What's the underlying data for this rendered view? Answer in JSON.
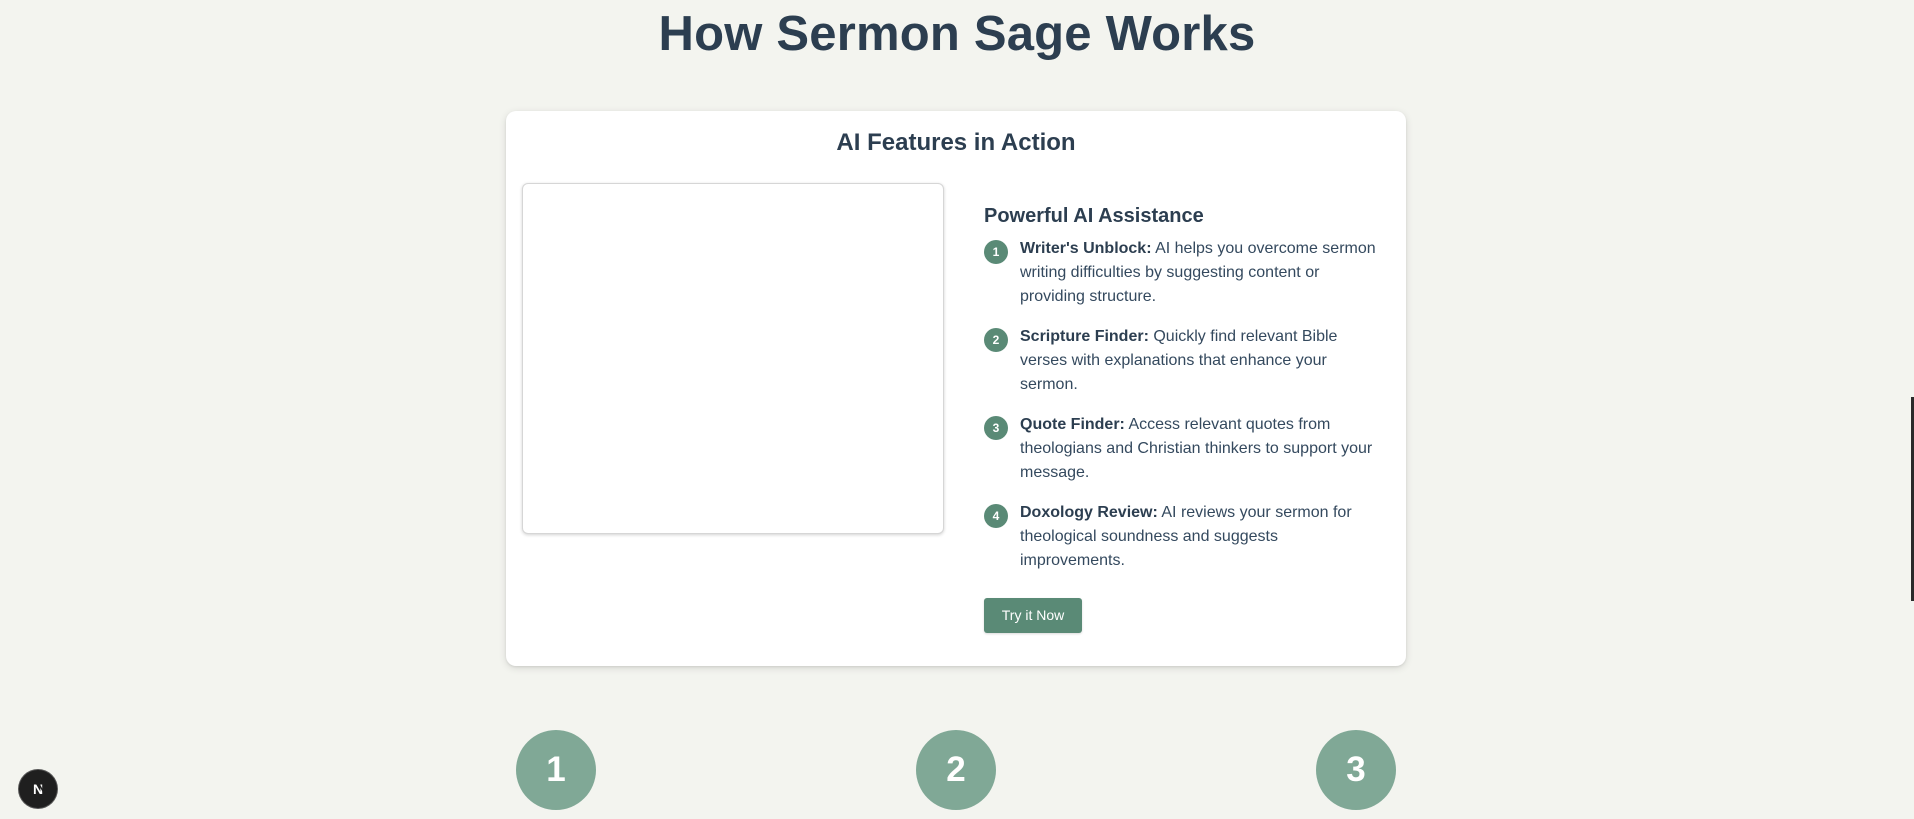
{
  "page": {
    "title": "How Sermon Sage Works"
  },
  "card": {
    "title": "AI Features in Action",
    "features_heading": "Powerful AI Assistance",
    "features": [
      {
        "number": "1",
        "name": "Writer's Unblock:",
        "description": " AI helps you overcome sermon writing difficulties by suggesting content or providing structure."
      },
      {
        "number": "2",
        "name": "Scripture Finder:",
        "description": " Quickly find relevant Bible verses with explanations that enhance your sermon."
      },
      {
        "number": "3",
        "name": "Quote Finder:",
        "description": " Access relevant quotes from theologians and Christian thinkers to support your message."
      },
      {
        "number": "4",
        "name": "Doxology Review:",
        "description": " AI reviews your sermon for theological soundness and suggests improvements."
      }
    ],
    "button_label": "Try it Now"
  },
  "steps": [
    {
      "number": "1"
    },
    {
      "number": "2"
    },
    {
      "number": "3"
    }
  ],
  "badge": {
    "icon": "nextjs-logo-icon",
    "letter": "N"
  },
  "colors": {
    "background": "#f3f4ef",
    "heading": "#2c3e50",
    "accent": "#5a8a76",
    "step_circle": "#80a896"
  }
}
